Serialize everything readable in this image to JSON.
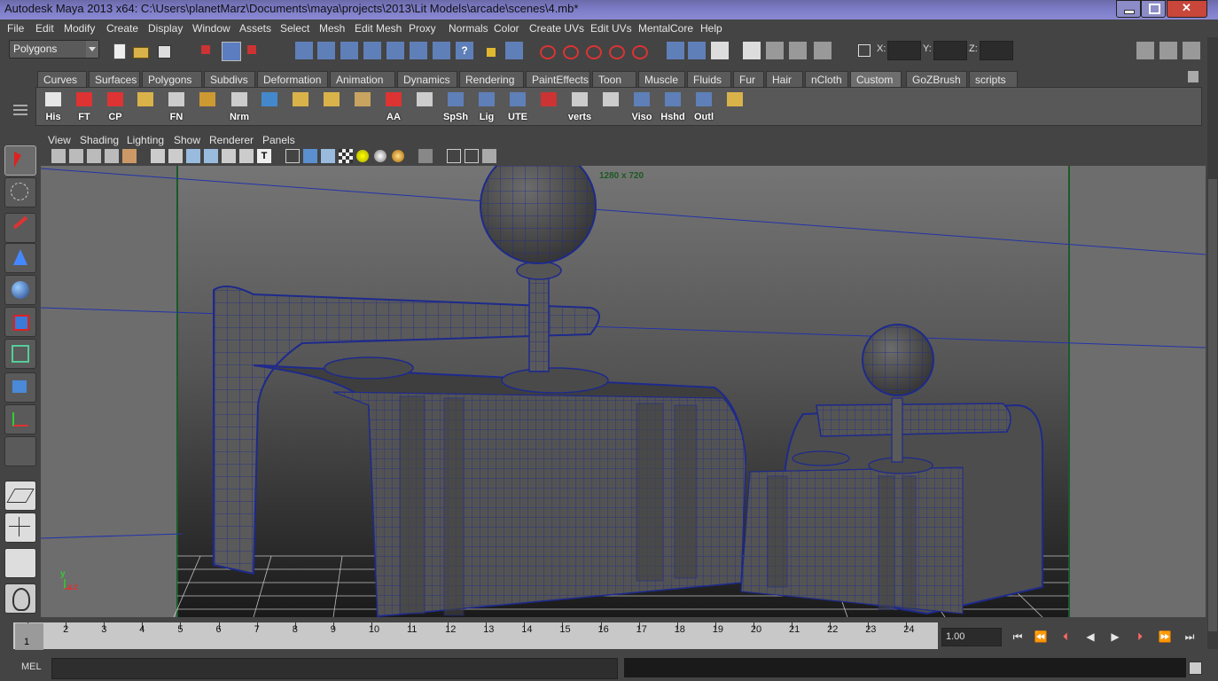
{
  "window": {
    "title": "Autodesk Maya 2013 x64: C:\\Users\\planetMarz\\Documents\\maya\\projects\\2013\\Lit Models\\arcade\\scenes\\4.mb*"
  },
  "menus": [
    "File",
    "Edit",
    "Modify",
    "Create",
    "Display",
    "Window",
    "Assets",
    "Select",
    "Mesh",
    "Edit Mesh",
    "Proxy",
    "Normals",
    "Color",
    "Create UVs",
    "Edit UVs",
    "MentalCore",
    "Help"
  ],
  "status": {
    "menuset": "Polygons",
    "x_label": "X:",
    "y_label": "Y:",
    "z_label": "Z:",
    "x_value": "",
    "y_value": "",
    "z_value": ""
  },
  "shelf": {
    "tabs": [
      "Curves",
      "Surfaces",
      "Polygons",
      "Subdivs",
      "Deformation",
      "Animation",
      "Dynamics",
      "Rendering",
      "PaintEffects",
      "Toon",
      "Muscle",
      "Fluids",
      "Fur",
      "Hair",
      "nCloth",
      "Custom",
      "GoZBrush",
      "scripts"
    ],
    "active_tab": "Custom",
    "buttons": [
      "His",
      "FT",
      "CP",
      "",
      "FN",
      "",
      "Nrm",
      "",
      "",
      "",
      "",
      "AA",
      "",
      "SpSh",
      "Lig",
      "UTE",
      "",
      "verts",
      "",
      "Viso",
      "Hshd",
      "Outl",
      ""
    ]
  },
  "panel": {
    "menus": [
      "View",
      "Shading",
      "Lighting",
      "Show",
      "Renderer",
      "Panels"
    ],
    "resolution_label": "1280 x 720",
    "axis_labels": {
      "y": "y",
      "x": "x",
      "z": "z"
    }
  },
  "timeline": {
    "frames": [
      "1",
      "2",
      "3",
      "4",
      "5",
      "6",
      "7",
      "8",
      "9",
      "10",
      "11",
      "12",
      "13",
      "14",
      "15",
      "16",
      "17",
      "18",
      "19",
      "20",
      "21",
      "22",
      "23",
      "24"
    ],
    "current_frame_marker": "1",
    "current_time": "1.00"
  },
  "command": {
    "mel_label": "MEL",
    "input": "",
    "result": ""
  },
  "colors": {
    "title_bar": "#7a79c3",
    "ui_bg": "#444444",
    "wire": "#1e2a8c",
    "active_tab": "#6e6e6e"
  }
}
